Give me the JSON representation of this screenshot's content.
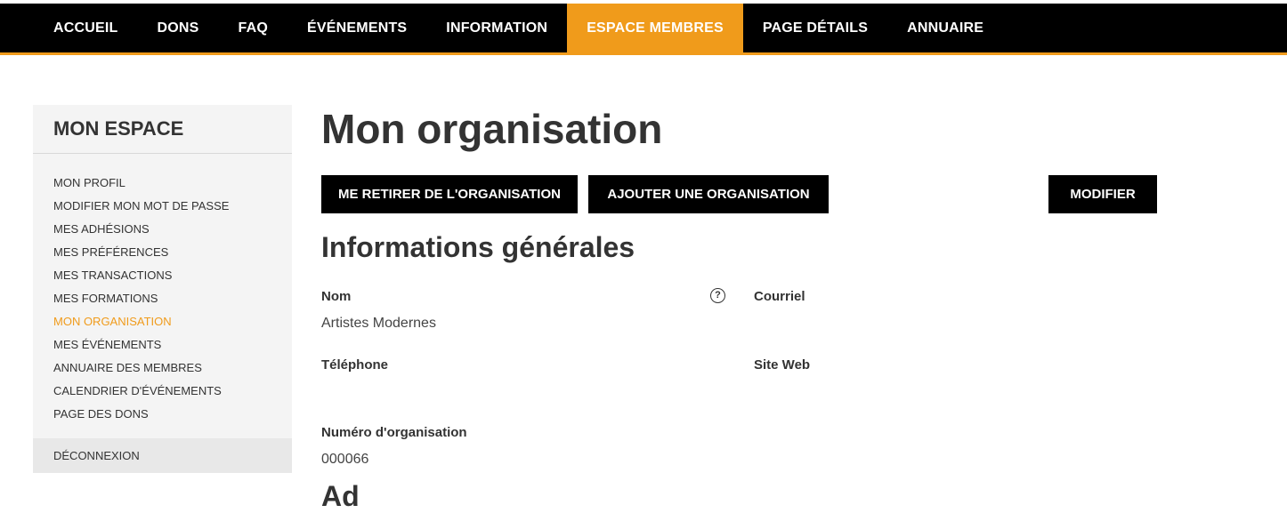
{
  "nav": {
    "items": [
      {
        "label": "ACCUEIL"
      },
      {
        "label": "DONS"
      },
      {
        "label": "FAQ"
      },
      {
        "label": "ÉVÉNEMENTS"
      },
      {
        "label": "INFORMATION"
      },
      {
        "label": "ESPACE MEMBRES",
        "active": true
      },
      {
        "label": "PAGE DÉTAILS"
      },
      {
        "label": "ANNUAIRE"
      }
    ]
  },
  "sidebar": {
    "title": "MON ESPACE",
    "items": [
      {
        "label": "MON PROFIL"
      },
      {
        "label": "MODIFIER MON MOT DE PASSE"
      },
      {
        "label": "MES ADHÉSIONS"
      },
      {
        "label": "MES PRÉFÉRENCES"
      },
      {
        "label": "MES TRANSACTIONS"
      },
      {
        "label": "MES FORMATIONS"
      },
      {
        "label": "MON ORGANISATION",
        "active": true
      },
      {
        "label": "MES ÉVÉNEMENTS"
      },
      {
        "label": "ANNUAIRE DES MEMBRES"
      },
      {
        "label": "CALENDRIER D'ÉVÉNEMENTS"
      },
      {
        "label": "PAGE DES DONS"
      }
    ],
    "logout": "DÉCONNEXION"
  },
  "main": {
    "title": "Mon organisation",
    "buttons": {
      "leave": "ME RETIRER DE L'ORGANISATION",
      "add": "AJOUTER UNE ORGANISATION",
      "edit": "MODIFIER"
    },
    "section_title": "Informations générales",
    "help_icon": "?",
    "fields": {
      "name_label": "Nom",
      "name_value": "Artistes Modernes",
      "email_label": "Courriel",
      "phone_label": "Téléphone",
      "website_label": "Site Web",
      "org_number_label": "Numéro d'organisation",
      "org_number_value": "000066"
    },
    "next_heading_partial": "Ad"
  },
  "colors": {
    "accent": "#f09b1b",
    "nav_bg": "#000000",
    "sidebar_bg": "#f4f4f4"
  }
}
